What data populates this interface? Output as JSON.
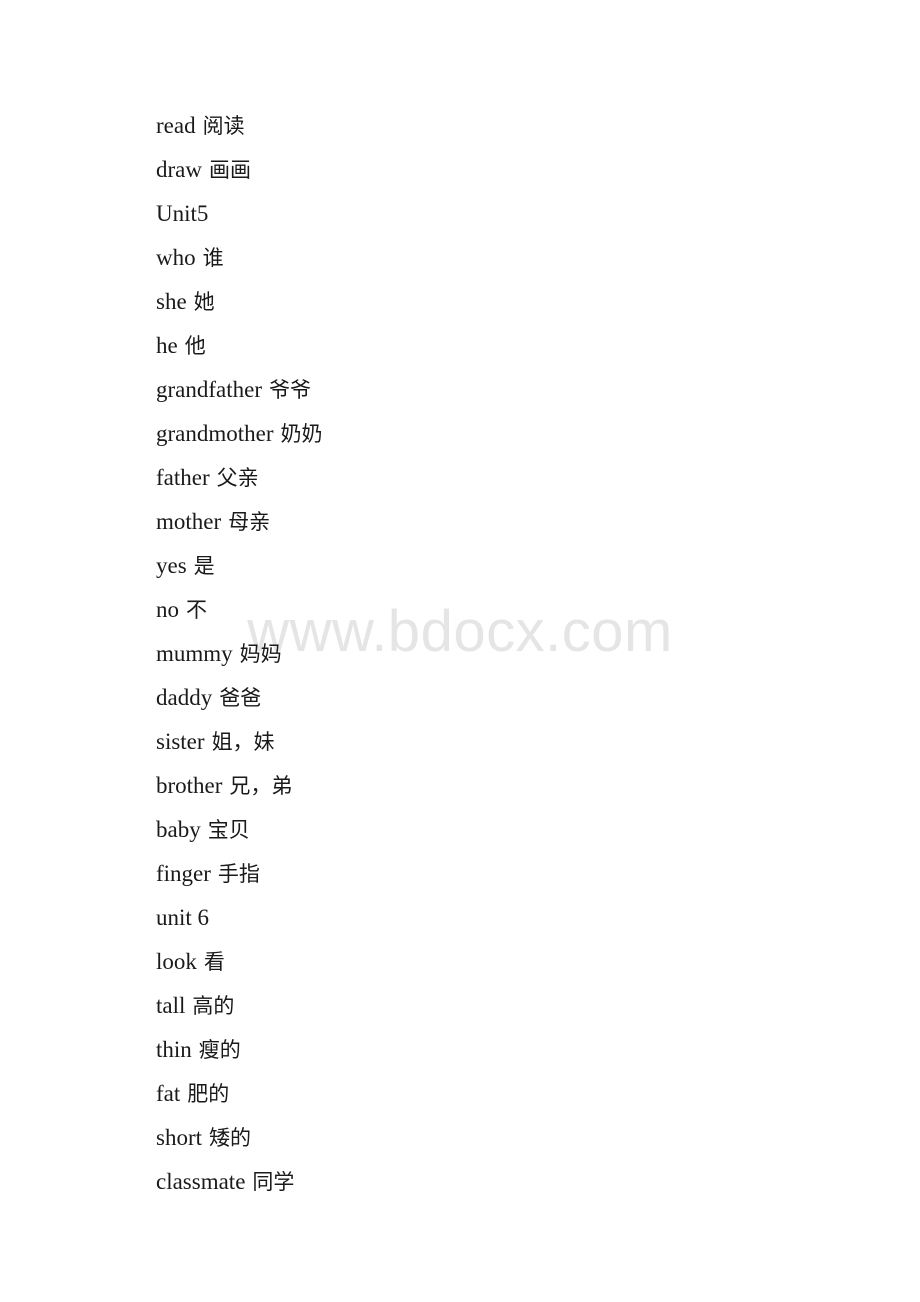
{
  "document": {
    "type": "vocabulary-word-list",
    "background_color": "#ffffff",
    "text_color": "#1a1a1a"
  },
  "watermark": {
    "text": "www.bdocx.com",
    "color": "#e5e5e5"
  },
  "entries": [
    {
      "term": "read",
      "gloss": "阅读"
    },
    {
      "term": "draw",
      "gloss": "画画"
    },
    {
      "term": "Unit5",
      "gloss": ""
    },
    {
      "term": "who",
      "gloss": "谁"
    },
    {
      "term": "she",
      "gloss": "她"
    },
    {
      "term": "he",
      "gloss": "他"
    },
    {
      "term": "grandfather",
      "gloss": "爷爷"
    },
    {
      "term": "grandmother",
      "gloss": "奶奶"
    },
    {
      "term": "father",
      "gloss": "父亲"
    },
    {
      "term": "mother",
      "gloss": "母亲"
    },
    {
      "term": "yes",
      "gloss": "是"
    },
    {
      "term": "no",
      "gloss": "不"
    },
    {
      "term": "mummy",
      "gloss": "妈妈"
    },
    {
      "term": "daddy",
      "gloss": "爸爸"
    },
    {
      "term": "sister",
      "gloss": "姐，妹"
    },
    {
      "term": "brother",
      "gloss": "兄，弟"
    },
    {
      "term": "baby",
      "gloss": "宝贝"
    },
    {
      "term": "finger",
      "gloss": "手指"
    },
    {
      "term": "unit 6",
      "gloss": ""
    },
    {
      "term": "look",
      "gloss": "看"
    },
    {
      "term": "tall",
      "gloss": "高的"
    },
    {
      "term": "thin",
      "gloss": "瘦的"
    },
    {
      "term": "fat",
      "gloss": "肥的"
    },
    {
      "term": "short",
      "gloss": "矮的"
    },
    {
      "term": "classmate",
      "gloss": "同学"
    }
  ]
}
